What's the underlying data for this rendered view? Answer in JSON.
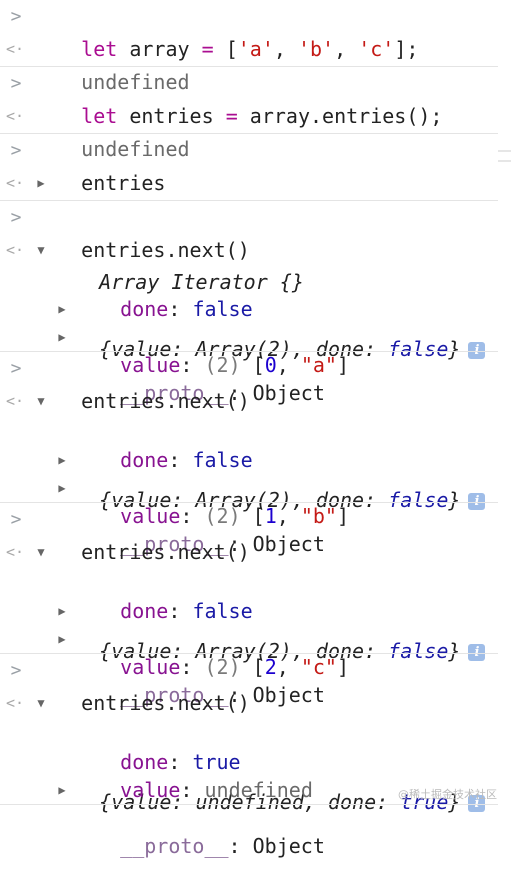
{
  "glyphs": {
    "prompt": ">",
    "result": "<·",
    "collapsed": "▶",
    "expanded": "▼",
    "info": "i"
  },
  "statements": {
    "let": "let",
    "array_var": "array",
    "eq": "=",
    "array_open": "[",
    "a": "'a'",
    "comma": ",",
    "b": "'b'",
    "c": "'c'",
    "array_close": "];",
    "entries_var": "entries",
    "entries_call": "array.entries();",
    "undefined": "undefined",
    "entries_eval": "entries",
    "iterator": "Array Iterator {}",
    "next_call": "entries.next()"
  },
  "iterations": [
    {
      "summary_value": "Array(2)",
      "summary_done": "false",
      "done": "false",
      "index": "0",
      "item": "\"a\""
    },
    {
      "summary_value": "Array(2)",
      "summary_done": "false",
      "done": "false",
      "index": "1",
      "item": "\"b\""
    },
    {
      "summary_value": "Array(2)",
      "summary_done": "false",
      "done": "false",
      "index": "2",
      "item": "\"c\""
    }
  ],
  "final": {
    "summary_value": "undefined",
    "summary_done": "true",
    "done": "true",
    "value": "undefined"
  },
  "labels": {
    "summary_open": "{value: ",
    "summary_mid": ", done: ",
    "summary_close": "}",
    "done": "done",
    "value": "value",
    "proto": "__proto__",
    "colon": ":",
    "object": "Object",
    "length": "(2)",
    "arr_open": "[",
    "arr_sep": ", ",
    "arr_close": "]"
  },
  "watermark": "@稀土掘金技术社区"
}
